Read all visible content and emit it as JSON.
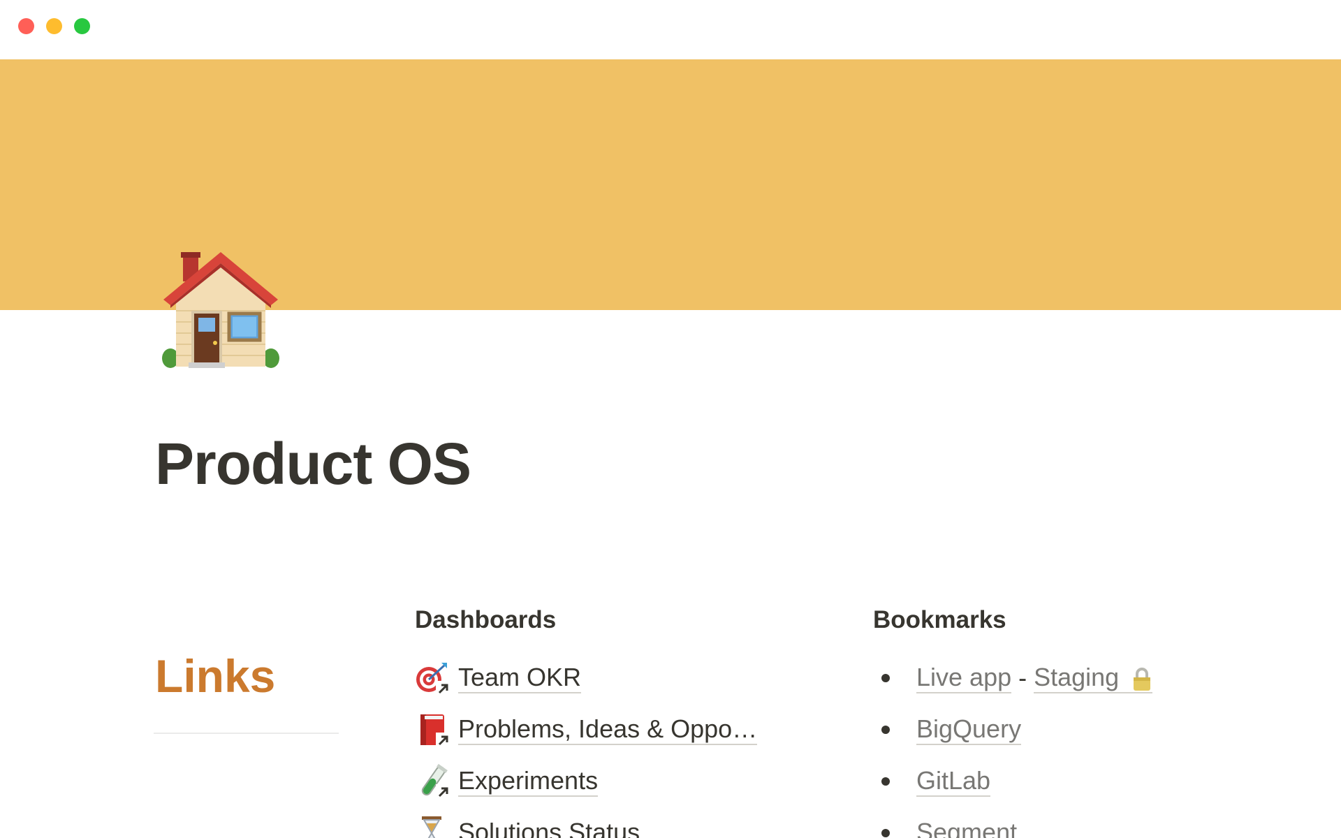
{
  "page": {
    "title": "Product OS",
    "icon": "house-icon",
    "cover_color": "#f0c165"
  },
  "links_section": {
    "heading": "Links",
    "heading_color": "#cb7a2e"
  },
  "dashboards": {
    "heading": "Dashboards",
    "items": [
      {
        "label": "Team OKR",
        "icon": "target-dart-icon"
      },
      {
        "label": "Problems, Ideas & Oppo…",
        "icon": "red-book-icon"
      },
      {
        "label": "Experiments",
        "icon": "test-tube-icon"
      },
      {
        "label": "Solutions Status",
        "icon": "hourglass-icon"
      }
    ]
  },
  "bookmarks": {
    "heading": "Bookmarks",
    "items": [
      {
        "label": "Live app",
        "separator": "-",
        "label2": "Staging",
        "icon": "lock-icon"
      },
      {
        "label": "BigQuery"
      },
      {
        "label": "GitLab"
      },
      {
        "label": "Segment"
      }
    ]
  },
  "window_controls": {
    "close_color": "#ff5f57",
    "minimize_color": "#febc2e",
    "maximize_color": "#28c840"
  }
}
